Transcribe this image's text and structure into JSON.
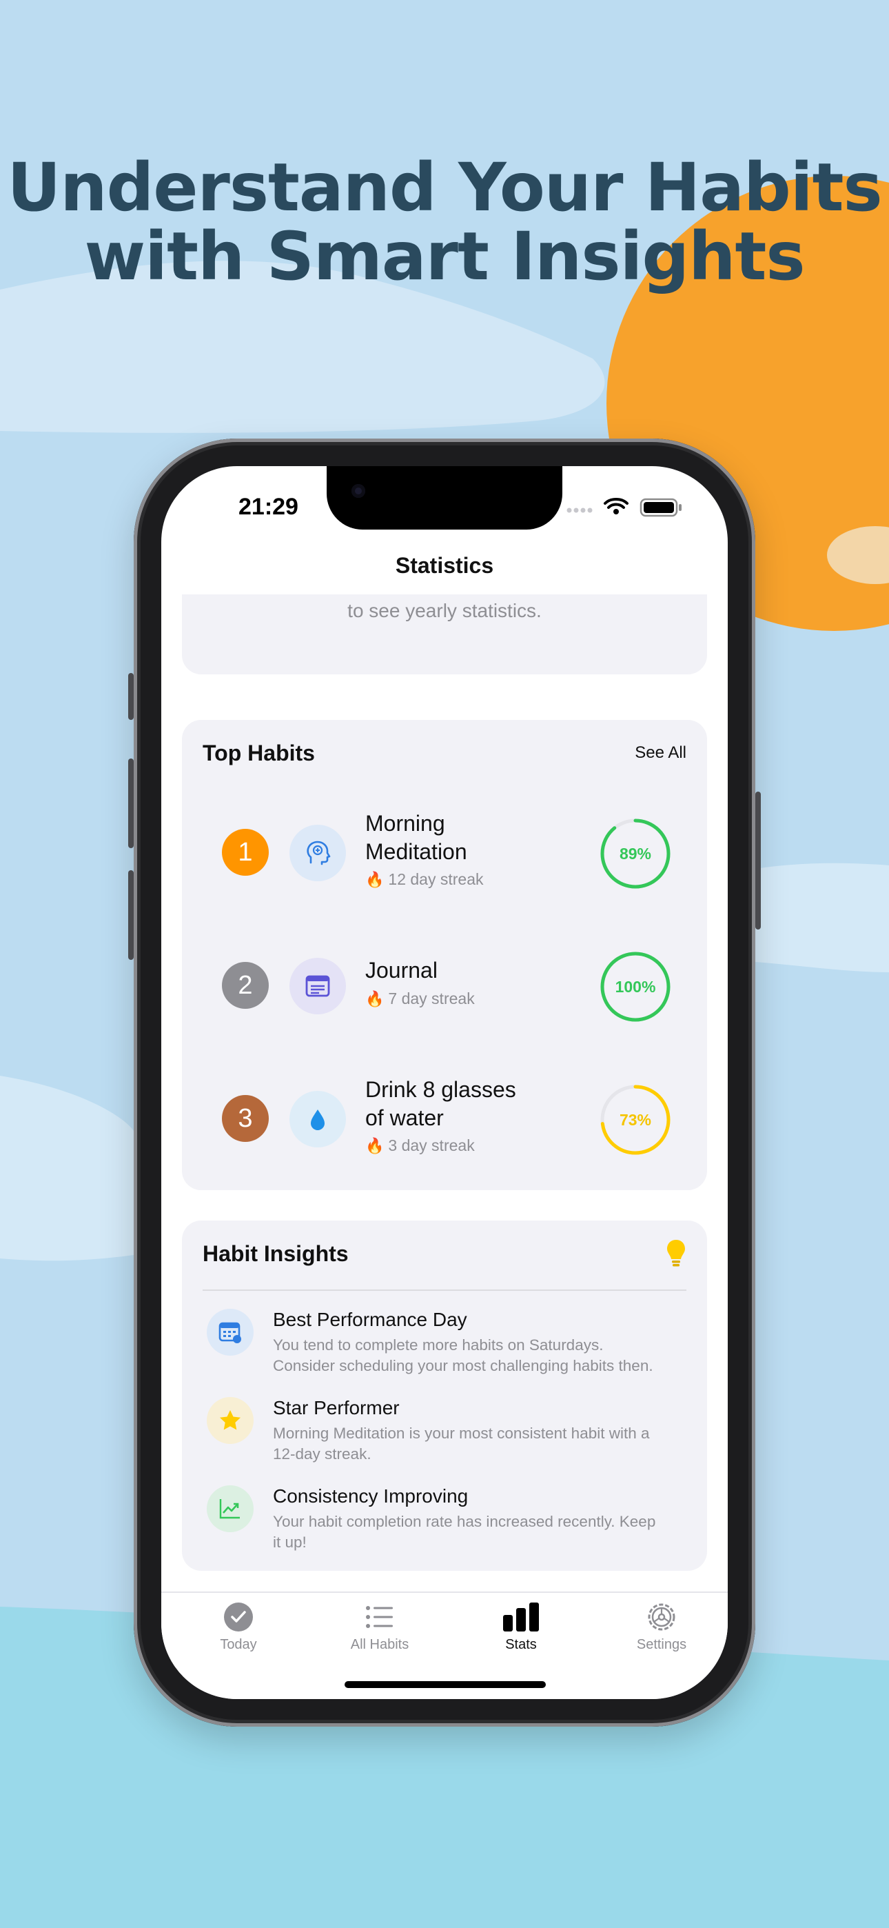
{
  "headline": {
    "line1": "Understand Your Habits",
    "line2": "with Smart Insights"
  },
  "status_bar": {
    "time": "21:29"
  },
  "nav": {
    "title": "Statistics"
  },
  "yearly_card": {
    "text": "to see yearly statistics."
  },
  "top_habits": {
    "title": "Top Habits",
    "see_all": "See All",
    "items": [
      {
        "rank": "1",
        "name_line1": "Morning",
        "name_line2": "Meditation",
        "streak": "12 day streak",
        "percent_label": "89%",
        "percent": 89,
        "rank_color": "#ff9500",
        "ring_color": "#34c759",
        "icon": "brain-head-icon"
      },
      {
        "rank": "2",
        "name_line1": "Journal",
        "name_line2": "",
        "streak": "7 day streak",
        "percent_label": "100%",
        "percent": 100,
        "rank_color": "#8e8e93",
        "ring_color": "#34c759",
        "icon": "journal-icon"
      },
      {
        "rank": "3",
        "name_line1": "Drink 8 glasses",
        "name_line2": "of water",
        "streak": "3 day streak",
        "percent_label": "73%",
        "percent": 73,
        "rank_color": "#b5683a",
        "ring_color": "#ffcc00",
        "icon": "water-drop-icon"
      }
    ]
  },
  "insights": {
    "title": "Habit Insights",
    "items": [
      {
        "title": "Best Performance Day",
        "desc_line1": "You tend to complete more habits on Saturdays.",
        "desc_line2": "Consider scheduling your most challenging habits then.",
        "icon": "calendar-icon"
      },
      {
        "title": "Star Performer",
        "desc_line1": "Morning Meditation is your most consistent habit with a",
        "desc_line2": "12-day streak.",
        "icon": "star-icon"
      },
      {
        "title": "Consistency Improving",
        "desc_line1": "Your habit completion rate has increased recently. Keep",
        "desc_line2": "it up!",
        "icon": "trend-up-icon"
      }
    ]
  },
  "tabbar": {
    "items": [
      {
        "label": "Today",
        "icon": "checkmark-circle-icon",
        "active": false
      },
      {
        "label": "All Habits",
        "icon": "list-icon",
        "active": false
      },
      {
        "label": "Stats",
        "icon": "bar-chart-icon",
        "active": true
      },
      {
        "label": "Settings",
        "icon": "gear-icon",
        "active": false
      }
    ]
  },
  "colors": {
    "sky": "#bcdcf1",
    "sun": "#f7a22c",
    "headline": "#2a4a5e",
    "card_bg": "#f2f2f7",
    "green": "#34c759",
    "yellow": "#ffcc00"
  }
}
